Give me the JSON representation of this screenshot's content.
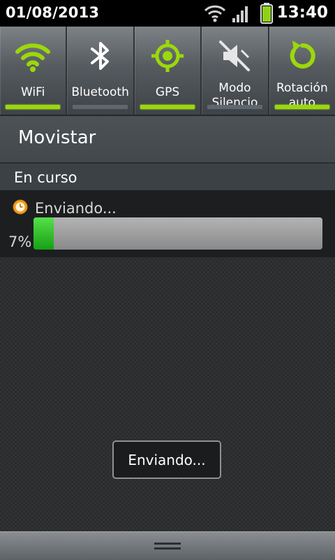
{
  "status_bar": {
    "date": "01/08/2013",
    "time": "13:40",
    "icons": [
      "wifi-icon",
      "signal-icon",
      "battery-icon"
    ]
  },
  "quick_toggles": [
    {
      "label": "WiFi",
      "icon": "wifi-icon",
      "state": "on"
    },
    {
      "label": "Bluetooth",
      "icon": "bluetooth-icon",
      "state": "off"
    },
    {
      "label": "GPS",
      "icon": "gps-icon",
      "state": "on"
    },
    {
      "label": "Modo\nSilencio",
      "icon": "mute-icon",
      "state": "off"
    },
    {
      "label": "Rotación\nauto",
      "icon": "rotation-icon",
      "state": "on"
    }
  ],
  "operator": "Movistar",
  "section_header": "En curso",
  "notification": {
    "icon": "clock-icon",
    "title": "Enviando...",
    "progress_text": "7%",
    "progress": 0.07
  },
  "toast": "Enviando...",
  "colors": {
    "accent_on": "#9bd80b",
    "progress_fill": "#2bbd22"
  }
}
